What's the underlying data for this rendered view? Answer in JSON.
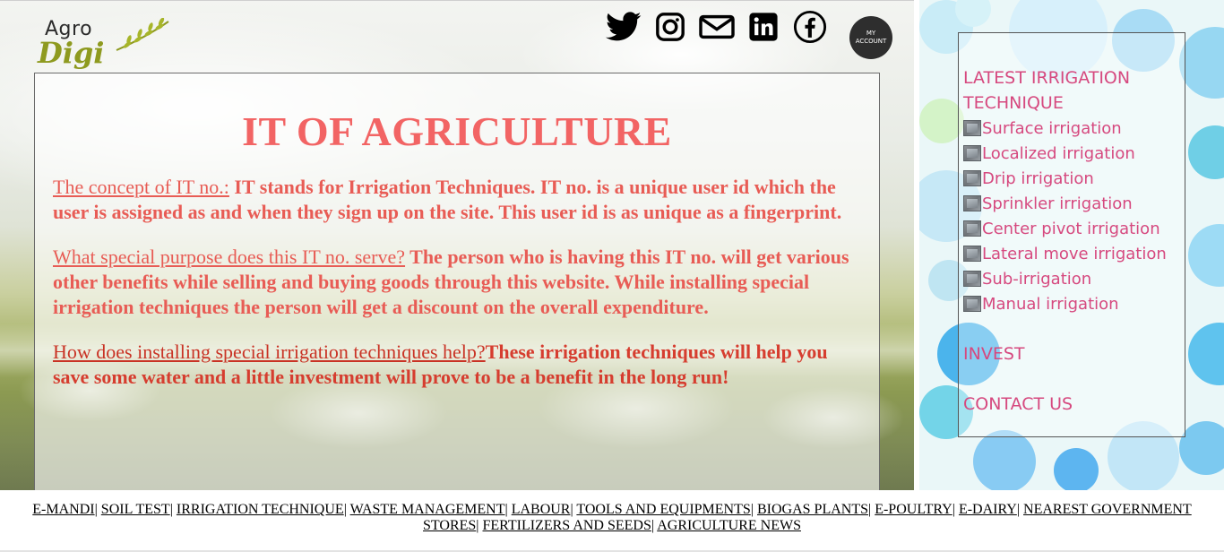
{
  "logo": {
    "text_top": "Agro",
    "text_bottom": "Digi"
  },
  "socials": [
    {
      "name": "twitter-icon"
    },
    {
      "name": "instagram-icon"
    },
    {
      "name": "mail-icon"
    },
    {
      "name": "linkedin-icon"
    },
    {
      "name": "facebook-icon"
    }
  ],
  "account": {
    "line1": "MY",
    "line2": "ACCOUNT"
  },
  "main": {
    "title": "IT OF AGRICULTURE",
    "paragraphs": [
      {
        "question": "The concept of IT no.:",
        "answer": " IT stands for Irrigation Techniques. IT no. is a unique user id which the user is assigned as and when they sign up on the site. This user id is as unique as a fingerprint."
      },
      {
        "question": "What special purpose does this IT no. serve?",
        "answer": " The person who is having this IT no. will get various other benefits while selling and buying goods through this website. While installing special irrigation techniques the person will get a discount on the overall expenditure."
      },
      {
        "question": "How does installing special irrigation techniques help?",
        "answer": "These irrigation techniques will help you save some water and a little investment will prove to be a benefit in the long run!"
      }
    ]
  },
  "sidebar": {
    "heading": "LATEST IRRIGATION TECHNIQUE",
    "items": [
      "Surface irrigation",
      "Localized irrigation",
      "Drip irrigation",
      "Sprinkler irrigation",
      "Center pivot irrigation",
      "Lateral move irrigation",
      "Sub-irrigation",
      "Manual irrigation"
    ],
    "invest": "INVEST",
    "contact": "CONTACT US"
  },
  "footer": {
    "links": [
      "E-MANDI",
      "SOIL TEST",
      "IRRIGATION TECHNIQUE",
      "WASTE MANAGEMENT",
      "LABOUR",
      "TOOLS AND EQUIPMENTS",
      "BIOGAS PLANTS",
      "E-POULTRY",
      "E-DAIRY",
      "NEAREST GOVERNMENT STORES",
      "FERTILIZERS AND SEEDS",
      "AGRICULTURE NEWS"
    ],
    "separator": "| "
  },
  "colors": {
    "title": "#f26464",
    "body_text": "#e85c55",
    "sidebar_text": "#d6497f",
    "account_bg": "#2e2e2e"
  }
}
